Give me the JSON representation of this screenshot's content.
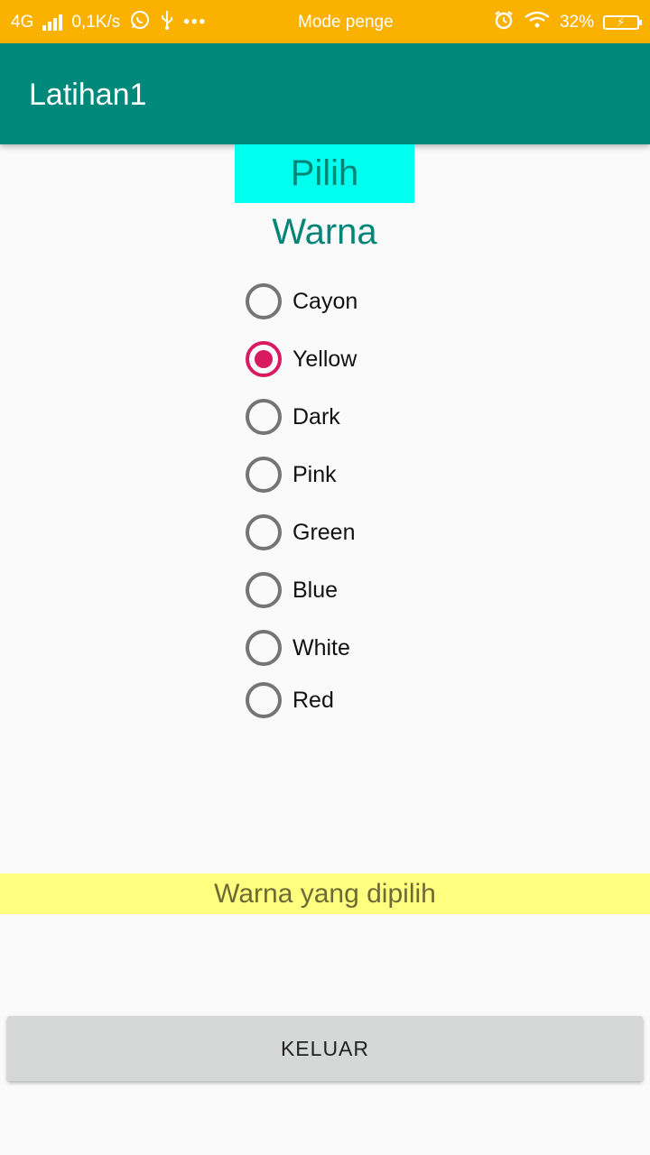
{
  "status_bar": {
    "network": "4G",
    "speed": "0,1K/s",
    "more": "•••",
    "notification": "Mode penge",
    "battery_percent": "32%",
    "battery_level": 0.32,
    "background_color": "#fbb100"
  },
  "app_bar": {
    "title": "Latihan1",
    "background_color": "#00897b"
  },
  "heading": {
    "text": "Pilih Warna",
    "background_color": "#00ffee",
    "text_color": "#008577"
  },
  "radio_options": [
    {
      "label": "Cayon",
      "checked": false
    },
    {
      "label": "Yellow",
      "checked": true
    },
    {
      "label": "Dark",
      "checked": false
    },
    {
      "label": "Pink",
      "checked": false
    },
    {
      "label": "Green",
      "checked": false
    },
    {
      "label": "Blue",
      "checked": false
    },
    {
      "label": "White",
      "checked": false
    },
    {
      "label": "Red",
      "checked": false
    }
  ],
  "radio_accent_color": "#d81b60",
  "result": {
    "text": "Warna yang dipilih",
    "background_color": "#ffff80"
  },
  "exit_button": {
    "label": "KELUAR"
  }
}
